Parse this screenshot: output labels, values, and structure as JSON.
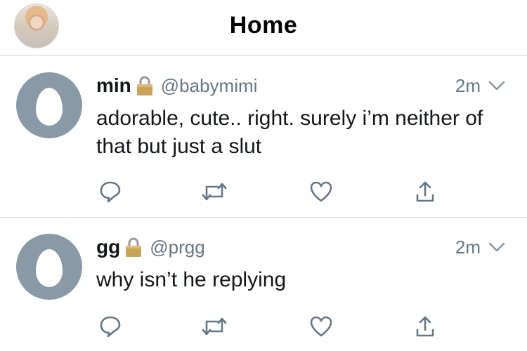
{
  "header": {
    "title": "Home"
  },
  "tweets": [
    {
      "name": "min",
      "handle": "@babymimi",
      "time": "2m",
      "text": "adorable, cute.. right. surely i’m neither of that but just a slut"
    },
    {
      "name": "gg",
      "handle": "@prgg",
      "time": "2m",
      "text": "why isn’t he replying"
    }
  ],
  "icons": {
    "reply": "reply-icon",
    "retweet": "retweet-icon",
    "like": "heart-icon",
    "share": "share-icon",
    "lock": "lock-icon",
    "caret": "chevron-down-icon",
    "default_avatar": "egg-avatar"
  },
  "colors": {
    "text": "#14171a",
    "secondary": "#657786",
    "divider": "#d3d6db",
    "egg_background": "#8a99a6",
    "lock_gold": "#c9a35a"
  }
}
